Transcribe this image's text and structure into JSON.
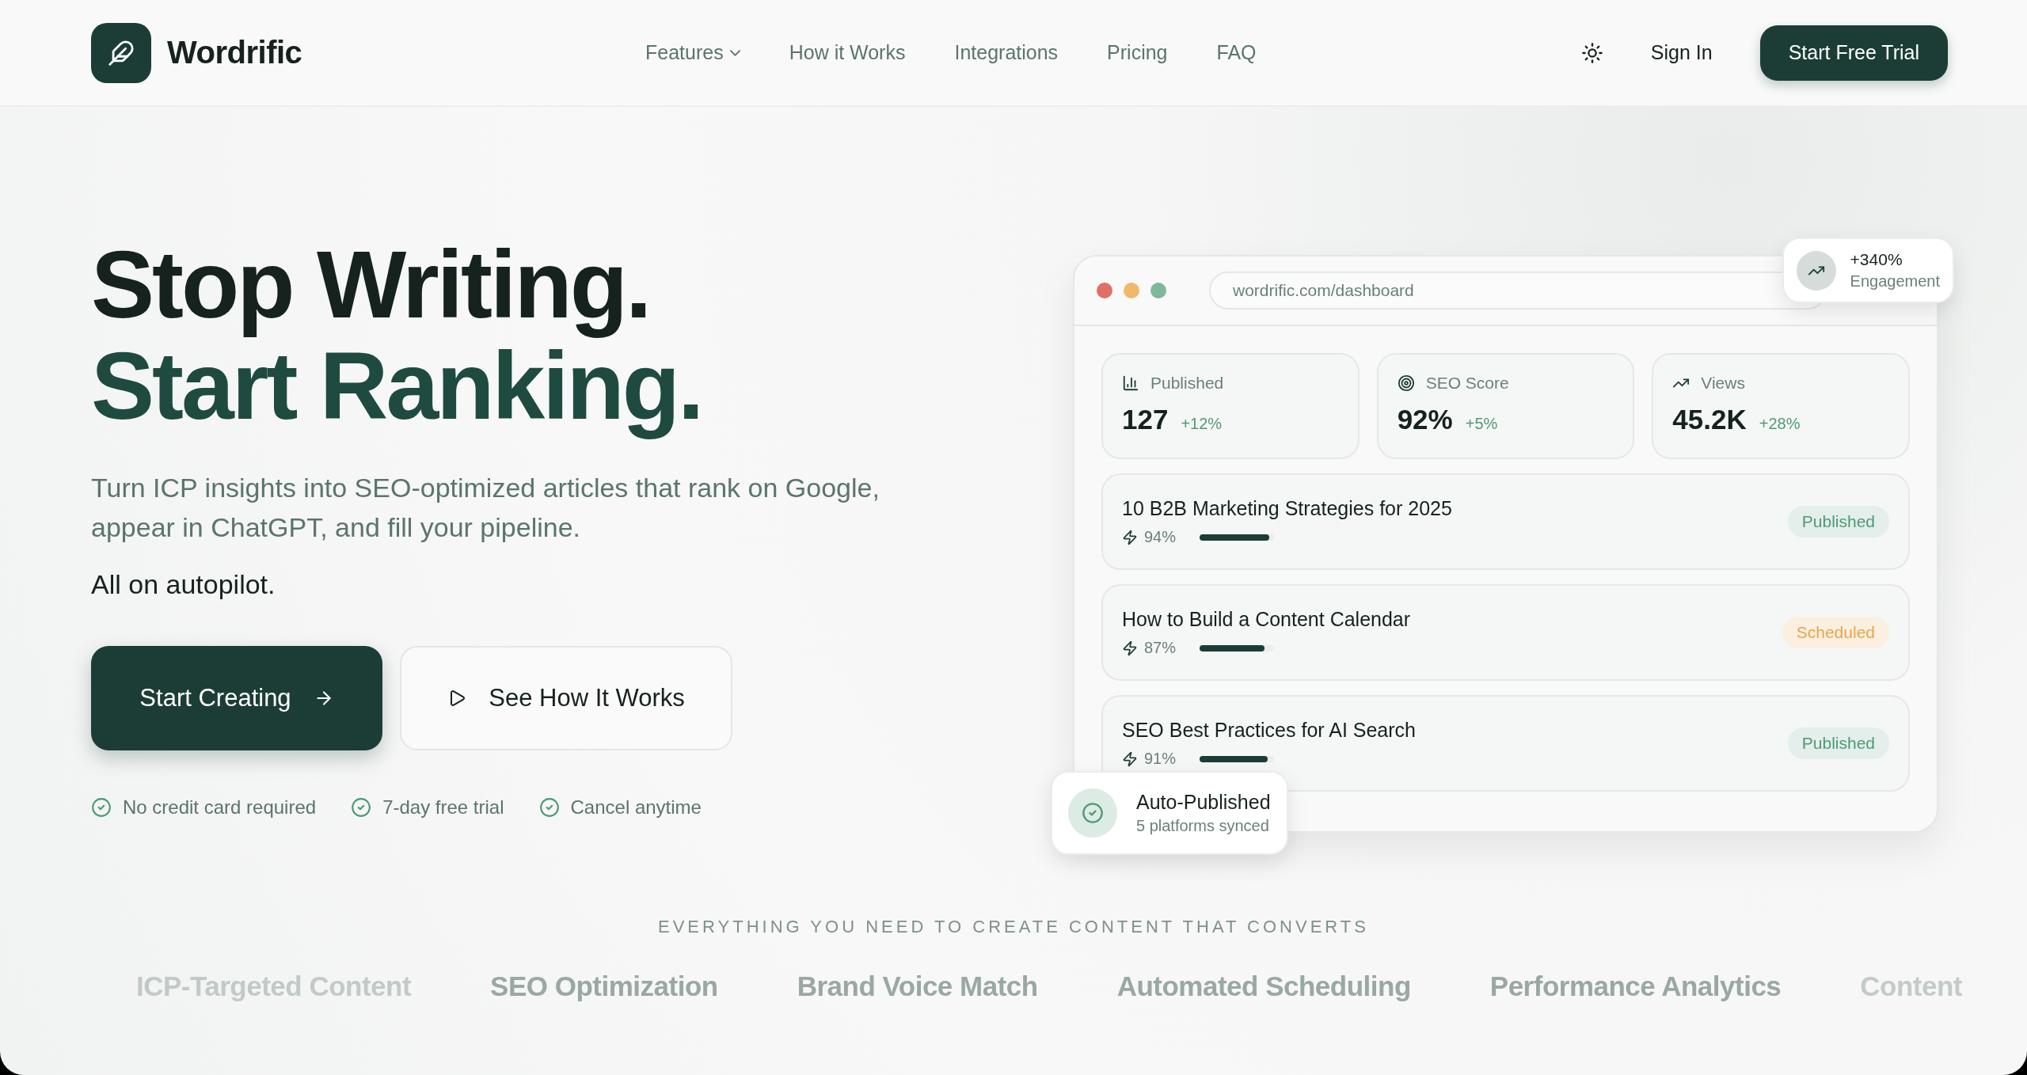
{
  "header": {
    "brand": "Wordrific",
    "nav": [
      {
        "label": "Features",
        "dropdown": true
      },
      {
        "label": "How it Works",
        "dropdown": false
      },
      {
        "label": "Integrations",
        "dropdown": false
      },
      {
        "label": "Pricing",
        "dropdown": false
      },
      {
        "label": "FAQ",
        "dropdown": false
      }
    ],
    "sign_in": "Sign In",
    "cta": "Start Free Trial"
  },
  "hero": {
    "title_lines": [
      "Stop Writing.",
      "Start Ranking."
    ],
    "subtitle": "Turn ICP insights into SEO-optimized articles that rank on Google, appear in ChatGPT, and fill your pipeline.",
    "tagline": "All on autopilot.",
    "primary_button": "Start Creating",
    "secondary_button": "See How It Works",
    "perks": [
      "No credit card required",
      "7-day free trial",
      "Cancel anytime"
    ]
  },
  "dashboard": {
    "url": "wordrific.com/dashboard",
    "stats": [
      {
        "kind": "published",
        "label": "Published",
        "value": "127",
        "change": "+12%"
      },
      {
        "kind": "seo",
        "label": "SEO Score",
        "value": "92%",
        "change": "+5%"
      },
      {
        "kind": "views",
        "label": "Views",
        "value": "45.2K",
        "change": "+28%"
      }
    ],
    "articles": [
      {
        "title": "10 B2B Marketing Strategies for 2025",
        "score": "94%",
        "level": 0.94,
        "status": "Published",
        "kind": "published"
      },
      {
        "title": "How to Build a Content Calendar",
        "score": "87%",
        "level": 0.87,
        "status": "Scheduled",
        "kind": "scheduled"
      },
      {
        "title": "SEO Best Practices for AI Search",
        "score": "91%",
        "level": 0.91,
        "status": "Published",
        "kind": "published"
      }
    ],
    "engagement_badge": {
      "value": "+340%",
      "label": "Engagement"
    },
    "toast": {
      "title": "Auto-Published",
      "subtitle": "5 platforms synced"
    }
  },
  "features_strip": {
    "heading": "EVERYTHING YOU NEED TO CREATE CONTENT THAT CONVERTS",
    "items": [
      "ICP-Targeted Content",
      "SEO Optimization",
      "Brand Voice Match",
      "Automated Scheduling",
      "Performance Analytics",
      "Content"
    ]
  }
}
